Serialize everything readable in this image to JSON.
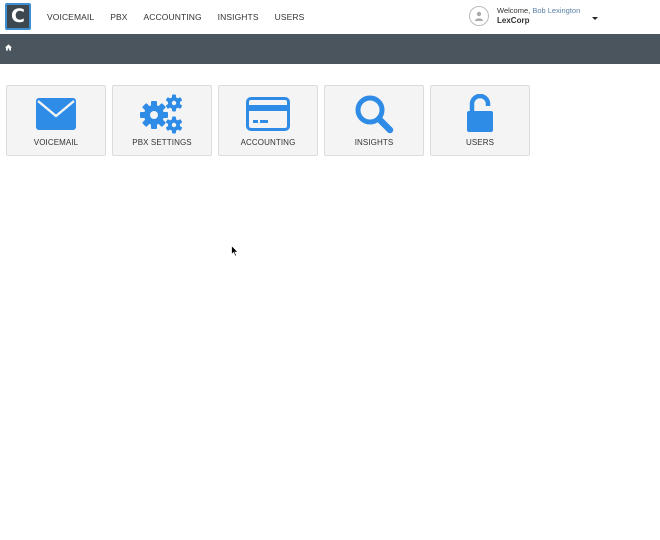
{
  "header": {
    "logo_letter": "C",
    "nav": [
      {
        "label": "VOICEMAIL"
      },
      {
        "label": "PBX"
      },
      {
        "label": "ACCOUNTING"
      },
      {
        "label": "INSIGHTS"
      },
      {
        "label": "USERS"
      }
    ],
    "user": {
      "welcome_prefix": "Welcome,",
      "name": "Bob Lexington",
      "company": "LexCorp"
    }
  },
  "breadcrumb": {
    "home_icon": "home-icon"
  },
  "tiles": [
    {
      "label": "VOICEMAIL",
      "icon": "envelope-icon"
    },
    {
      "label": "PBX SETTINGS",
      "icon": "gears-icon"
    },
    {
      "label": "ACCOUNTING",
      "icon": "credit-card-icon"
    },
    {
      "label": "INSIGHTS",
      "icon": "search-icon"
    },
    {
      "label": "USERS",
      "icon": "unlock-icon"
    }
  ],
  "colors": {
    "accent": "#3d8fd1",
    "icon_blue": "#2f8ce6",
    "breadcrumb_bar": "#4a555d",
    "logo_bg": "#3c4750",
    "tile_bg": "#f4f4f4"
  }
}
